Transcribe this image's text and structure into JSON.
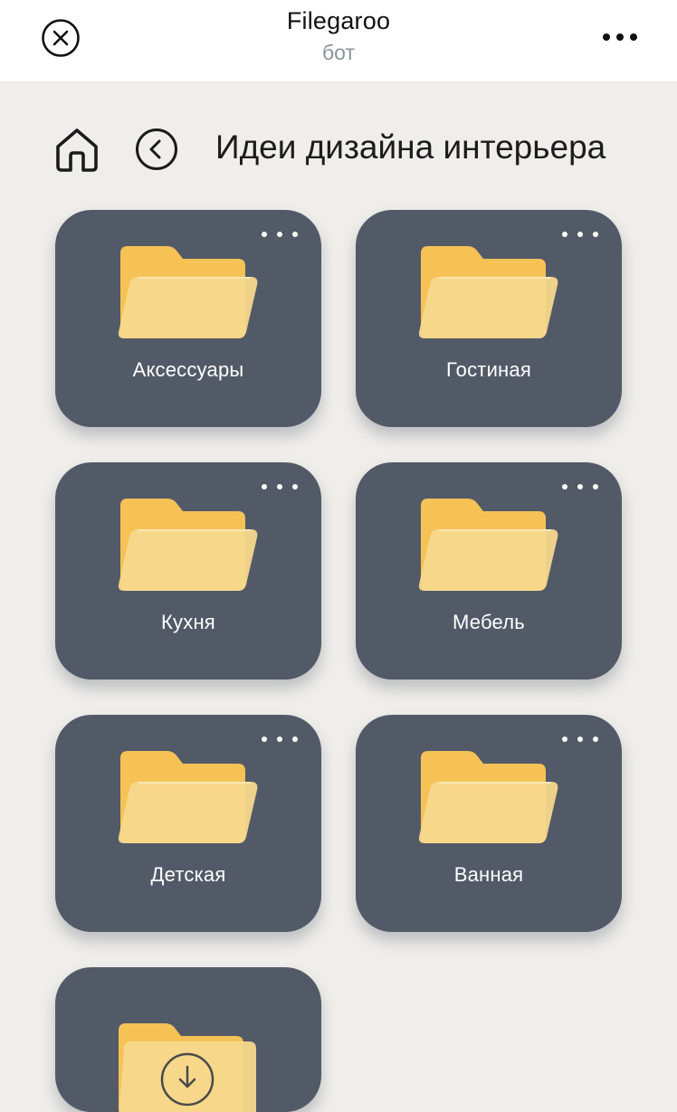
{
  "header": {
    "title": "Filegaroo",
    "subtitle": "бот"
  },
  "nav": {
    "page_title": "Идеи дизайна интерьера"
  },
  "folders": [
    {
      "label": "Аксессуары"
    },
    {
      "label": "Гостиная"
    },
    {
      "label": "Кухня"
    },
    {
      "label": "Мебель"
    },
    {
      "label": "Детская"
    },
    {
      "label": "Ванная"
    },
    {
      "label": ""
    }
  ],
  "colors": {
    "card": "#525a68",
    "folder_back": "#f6c256",
    "folder_front": "#f7d88c",
    "background": "#efeeea"
  },
  "icons": {
    "close": "close-icon",
    "more": "more-horizontal-icon",
    "home": "home-icon",
    "back": "chevron-left-circle-icon",
    "folder": "folder-icon",
    "upload": "download-circle-icon"
  }
}
